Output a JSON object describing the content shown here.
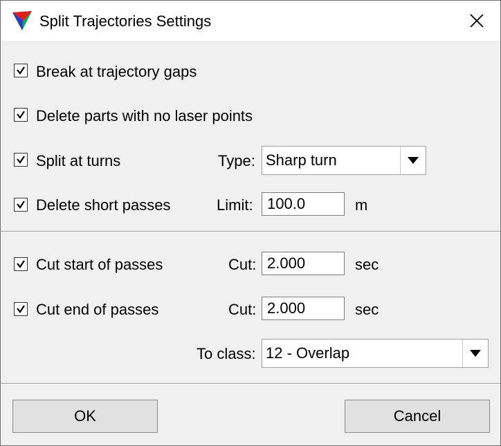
{
  "window": {
    "title": "Split Trajectories Settings"
  },
  "options": {
    "break_gaps": {
      "label": "Break at trajectory gaps",
      "checked": true
    },
    "delete_no_laser": {
      "label": "Delete parts with no laser points",
      "checked": true
    },
    "split_turns": {
      "label": "Split at turns",
      "checked": true,
      "type_label": "Type:",
      "type_value": "Sharp turn"
    },
    "delete_short": {
      "label": "Delete short passes",
      "checked": true,
      "limit_label": "Limit:",
      "limit_value": "100.0",
      "limit_unit": "m"
    },
    "cut_start": {
      "label": "Cut start of passes",
      "checked": true,
      "cut_label": "Cut:",
      "cut_value": "2.000",
      "cut_unit": "sec"
    },
    "cut_end": {
      "label": "Cut end of passes",
      "checked": true,
      "cut_label": "Cut:",
      "cut_value": "2.000",
      "cut_unit": "sec"
    },
    "to_class": {
      "label": "To class:",
      "value": "12 - Overlap"
    }
  },
  "buttons": {
    "ok": "OK",
    "cancel": "Cancel"
  },
  "icons": {
    "close": "close-icon",
    "app": "terrasolid-triangle-icon",
    "dropdown": "chevron-down-icon",
    "check": "check-icon"
  }
}
